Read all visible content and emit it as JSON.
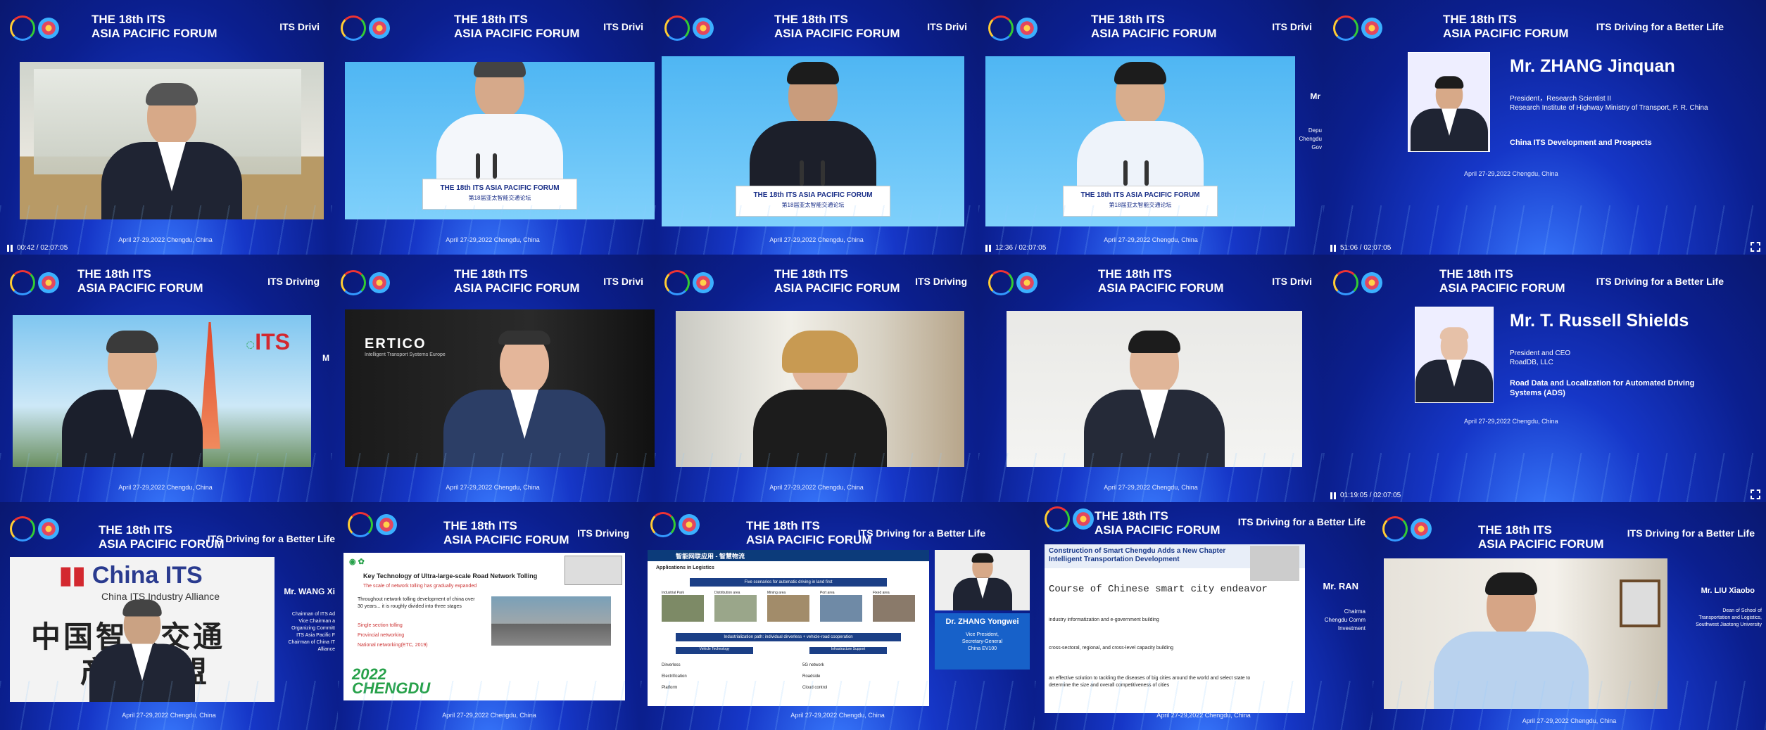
{
  "forum_line1": "THE 18th ITS",
  "forum_line2": "ASIA PACIFIC FORUM",
  "slogan": "ITS Driving for a Better Life",
  "slogan_short": "ITS Drivi",
  "slogan_med": "ITS Driving",
  "date_caption": "April 27-29,2022 Chengdu, China",
  "podium": {
    "line1": "THE 18th ITS ASIA PACIFIC FORUM",
    "line2": "第18届亚太智能交通论坛"
  },
  "tiles": {
    "t1": {
      "time": "00:42 / 02:07:05"
    },
    "t4": {
      "time": "12:36 / 02:07:05",
      "side_name": "Mr",
      "side_lines": [
        "Depu",
        "Chengdu",
        "Gov"
      ]
    },
    "t5": {
      "name": "Mr. ZHANG Jinquan",
      "role1": "President，Research Scientist II",
      "role2": "Research Institute of Highway Ministry of Transport, P. R. China",
      "topic": "China ITS Development and Prospects",
      "time": "51:06 / 02:07:05"
    },
    "t6": {
      "its_logo": "ITS",
      "side_name": "M"
    },
    "t7": {
      "logo": "ERTICO",
      "logo_sub": "Intelligent Transport Systems Europe"
    },
    "t10": {
      "name": "Mr. T. Russell Shields",
      "role1": "President and CEO",
      "role2": "RoadDB, LLC",
      "topic": "Road Data and Localization for Automated Driving Systems (ADS)",
      "time": "01:19:05 / 02:07:05"
    },
    "t11": {
      "brand": "China ITS",
      "brand_sub": "China ITS Industry Alliance",
      "cn_line1": "中国智能交通",
      "cn_line2": "产业联盟",
      "side_name": "Mr. WANG Xi",
      "side_lines": [
        "Chairman of ITS Ad",
        "Vice Chairman a",
        "Organizing Committ",
        "ITS Asia Pacific F",
        "Chairman of China IT",
        "Alliance"
      ]
    },
    "t12": {
      "slide_title": "Key Technology of Ultra-large-scale Road Network Tolling",
      "slide_sub": "The scale of network tolling has gradually expanded",
      "slide_body": "Throughout network tolling development of china over 30 years... it is roughly divided into three stages",
      "items": [
        "Single section tolling",
        "Provincial networking",
        "National networking(ETC, 2019)"
      ],
      "year_brand": "2022",
      "city_brand": "CHENGDU"
    },
    "t13": {
      "slide_title": "智能网联应用 - 智慧物流",
      "subtitle": "Applications in Logistics",
      "header": "Five scenarios for automatic driving in land first",
      "cols": [
        "Industrial Park",
        "Distribution area",
        "Mining area",
        "Port area",
        "Fixed area"
      ],
      "flow": "Industrialization path: individual dirverless + vehicle-road cooperation",
      "left_head": "Vehicle Technology",
      "right_head": "Infrastructure Support",
      "left_items": [
        "Dirverless",
        "Electrification",
        "Platform"
      ],
      "right_items": [
        "5G network",
        "Roadside",
        "Cloud control"
      ],
      "name": "Dr. ZHANG Yongwei",
      "role": [
        "Vice President,",
        "Secretary-General",
        "China EV100"
      ]
    },
    "t14": {
      "slide_title": "Construction of Smart Chengdu Adds a New Chapter",
      "slide_title2": "Intelligent Transportation Development",
      "heading": "Course of Chinese smart city endeavor",
      "p1": "industry informatization and e-government building",
      "p2": "cross-sectoral, regional, and cross-level capacity building",
      "p3": "an effective solution to tackling the diseases of big cities around the world and select state to determine the size and overall competitiveness of cities",
      "side_name": "Mr. RAN",
      "side_lines": [
        "Chairma",
        "Chengdu Comm",
        "Investment"
      ]
    },
    "t15": {
      "side_name": "Mr. LIU Xiaobo",
      "side_lines": [
        "Dean of School of",
        "Transportation and Logistics,",
        "Southwest Jiaotong University"
      ]
    }
  },
  "colors": {
    "background": "#0a1e8a",
    "accent_green": "#27a14a",
    "brand_red": "#d3282f"
  }
}
